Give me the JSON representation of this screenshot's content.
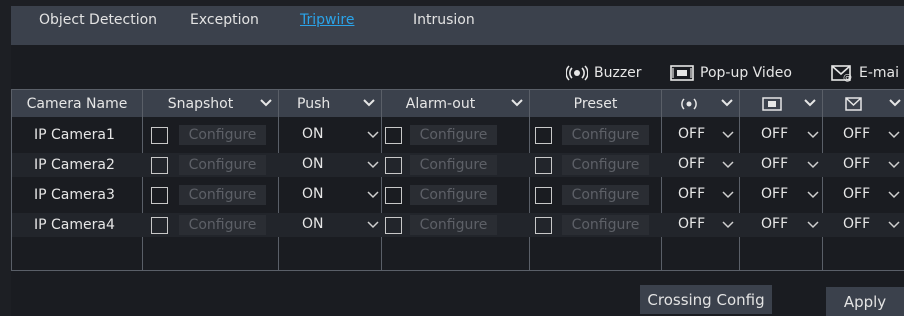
{
  "tabs": [
    {
      "label": "Object Detection",
      "active": false
    },
    {
      "label": "Exception",
      "active": false
    },
    {
      "label": "Tripwire",
      "active": true
    },
    {
      "label": "Intrusion",
      "active": false
    }
  ],
  "legend": {
    "buzzer": "Buzzer",
    "popup_video": "Pop-up Video",
    "email": "E-mai"
  },
  "headers": {
    "camera_name": "Camera Name",
    "snapshot": "Snapshot",
    "push": "Push",
    "alarm_out": "Alarm-out",
    "preset": "Preset"
  },
  "configure_label": "Configure",
  "rows": [
    {
      "camera": "IP Camera1",
      "push": "ON",
      "buzzer": "OFF",
      "popup": "OFF",
      "email": "OFF"
    },
    {
      "camera": "IP Camera2",
      "push": "ON",
      "buzzer": "OFF",
      "popup": "OFF",
      "email": "OFF"
    },
    {
      "camera": "IP Camera3",
      "push": "ON",
      "buzzer": "OFF",
      "popup": "OFF",
      "email": "OFF"
    },
    {
      "camera": "IP Camera4",
      "push": "ON",
      "buzzer": "OFF",
      "popup": "OFF",
      "email": "OFF"
    }
  ],
  "buttons": {
    "crossing_config": "Crossing Config",
    "apply": "Apply"
  },
  "colors": {
    "accent": "#2ba3e8",
    "header_bg": "#3b414c",
    "panel_bg": "#1a1c21"
  }
}
